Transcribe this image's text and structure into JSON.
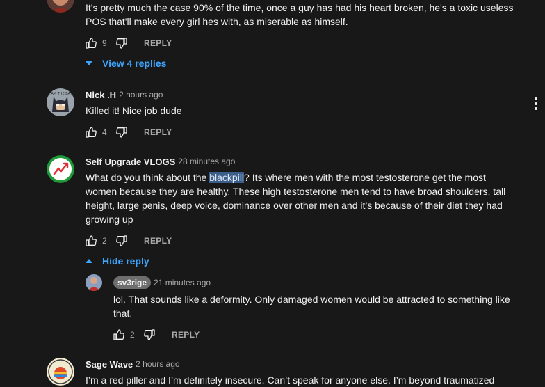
{
  "comments": [
    {
      "id": "c0",
      "text": "It's pretty much the case 90% of the time, once a guy has had his heart broken, he's a toxic useless POS that'll make every girl hes with, as miserable as himself.",
      "likes": "9",
      "reply_label": "REPLY",
      "replies_toggle": "View 4 replies"
    },
    {
      "id": "c1",
      "author": "Nick .H",
      "time": "2 hours ago",
      "avatar_text": "I AM THE BAT",
      "text": "Killed it! Nice job dude",
      "likes": "4",
      "reply_label": "REPLY"
    },
    {
      "id": "c2",
      "author": "Self Upgrade VLOGS",
      "time": "28 minutes ago",
      "text_before": "What do you think about the ",
      "text_highlight": "blackpill",
      "text_after": "? Its where men with the most testosterone get the most women because they are healthy. These high testosterone men tend to have broad shoulders, tall height, large penis, deep voice, dominance over other men and it’s because of their diet they had growing up",
      "likes": "2",
      "reply_label": "REPLY",
      "replies_toggle": "Hide reply"
    },
    {
      "id": "r1",
      "author": "sv3rige",
      "time": "21 minutes ago",
      "text": "lol. That sounds like a deformity. Only damaged women would be attracted to something like that.",
      "likes": "2",
      "reply_label": "REPLY"
    },
    {
      "id": "c3",
      "author": "Sage Wave",
      "time": "2 hours ago",
      "text": "I’m a red piller and I’m definitely insecure. Can’t speak for anyone else. I’m beyond traumatized"
    }
  ],
  "colors": {
    "background": "#181818",
    "link_blue": "#3ea6ff",
    "text_primary": "#f1f1f1",
    "text_secondary": "#aaaaaa",
    "highlight": "#3b5f8a"
  },
  "icons": [
    "thumbs-up-icon",
    "thumbs-down-icon",
    "caret-down-icon",
    "caret-up-icon",
    "more-vert-icon"
  ]
}
